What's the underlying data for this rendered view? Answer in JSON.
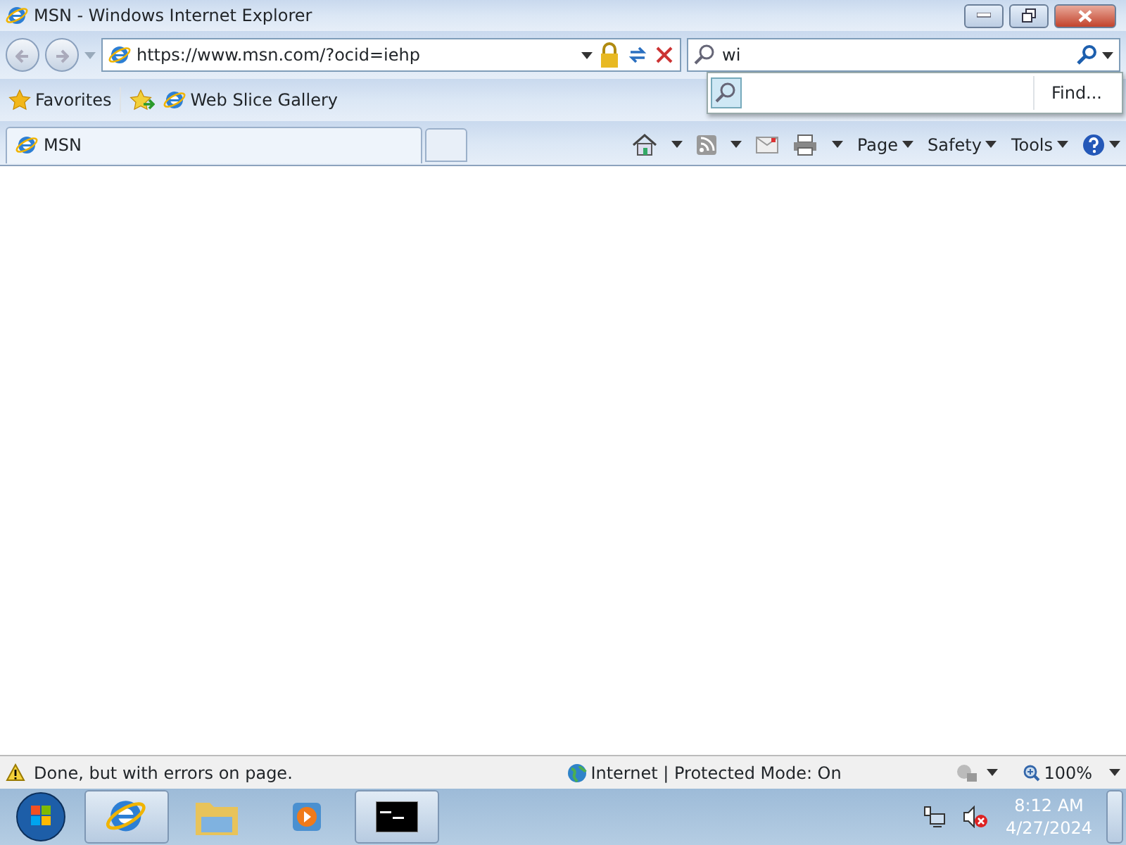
{
  "window": {
    "title": "MSN - Windows Internet Explorer"
  },
  "address_bar": {
    "url": "https://www.msn.com/?ocid=iehp"
  },
  "search": {
    "value": "wi",
    "find_button": "Find..."
  },
  "favorites_bar": {
    "favorites": "Favorites",
    "items": [
      {
        "label": "Web Slice Gallery"
      }
    ]
  },
  "tabs": [
    {
      "label": "MSN",
      "selected": true
    }
  ],
  "command_bar": [
    "Page",
    "Safety",
    "Tools"
  ],
  "status_bar": {
    "message": "Done, but with errors on page.",
    "zone": "Internet | Protected Mode: On",
    "zoom": "100%"
  },
  "taskbar": {
    "time": "8:12 AM",
    "date": "4/27/2024"
  }
}
